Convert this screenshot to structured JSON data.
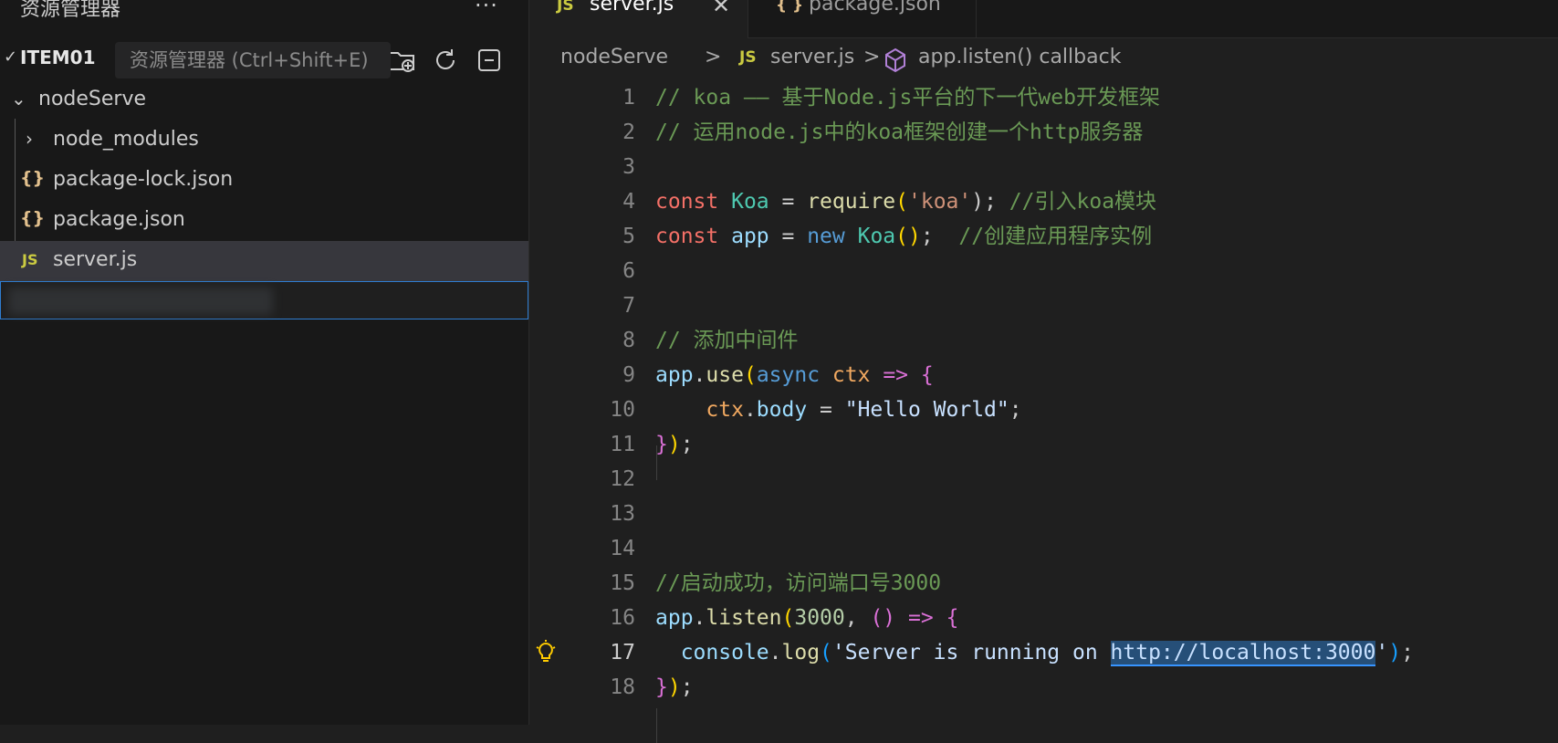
{
  "sidebar": {
    "title": "资源管理器",
    "more": "···",
    "section": "ITEM01",
    "tooltip": "资源管理器 (Ctrl+Shift+E)",
    "actions": [
      "new-file-icon",
      "new-folder-icon",
      "refresh-icon",
      "collapse-all-icon"
    ],
    "tree": [
      {
        "label": "nodeServe",
        "kind": "folder-open"
      },
      {
        "label": "node_modules",
        "kind": "folder-closed"
      },
      {
        "label": "package-lock.json",
        "kind": "json"
      },
      {
        "label": "package.json",
        "kind": "json"
      },
      {
        "label": "server.js",
        "kind": "js"
      }
    ]
  },
  "tabs": [
    {
      "icon": "JS",
      "label": "server.js",
      "active": true,
      "close": "✕"
    },
    {
      "icon": "{ }",
      "label": "package.json",
      "active": false
    }
  ],
  "breadcrumb": {
    "folder": "nodeServe",
    "sep": ">",
    "file_icon": "JS",
    "file": "server.js",
    "symbol": "app.listen() callback"
  },
  "code": {
    "line_numbers": [
      "1",
      "2",
      "3",
      "4",
      "5",
      "6",
      "7",
      "8",
      "9",
      "10",
      "11",
      "12",
      "13",
      "14",
      "15",
      "16",
      "17",
      "18"
    ],
    "current_line": "17",
    "l1": "// koa —— 基于Node.js平台的下一代web开发框架",
    "l2": "// 运用node.js中的koa框架创建一个http服务器",
    "l4": {
      "kw": "const",
      "cls": "Koa",
      "eq": " = ",
      "fn": "require",
      "op": "(",
      "str": "'koa'",
      "cl": ");",
      "com": " //引入koa模块"
    },
    "l5": {
      "kw": "const",
      "var": "app",
      "eq": " = ",
      "nw": "new",
      "cls": "Koa",
      "br": "()",
      "semi": ";",
      "com": "  //创建应用程序实例"
    },
    "l8": "// 添加中间件",
    "l9": {
      "obj": "app",
      "dot": ".",
      "fn": "use",
      "op": "(",
      "kw": "async",
      "ctx": "ctx",
      "arrow": "=>",
      "br": "{"
    },
    "l10": {
      "ctx": "ctx",
      "dot": ".",
      "prop": "body",
      "eq": " = ",
      "str": "\"Hello World\"",
      "semi": ";"
    },
    "l11": {
      "br": "}",
      "cl": ")",
      "semi": ";"
    },
    "l15": "//启动成功，访问端口号3000",
    "l16": {
      "obj": "app",
      "dot": ".",
      "fn": "listen",
      "op": "(",
      "num": "3000",
      "comma": ", ",
      "p": "()",
      "arrow": "=>",
      "br": "{"
    },
    "l17": {
      "obj": "console",
      "dot": ".",
      "fn": "log",
      "op": "(",
      "str1": "'Server is running on ",
      "url": "http://localhost:3000",
      "str2": "'",
      "cl": ")",
      "semi": ";"
    },
    "l18": {
      "br": "}",
      "cl": ")",
      "semi": ";"
    }
  }
}
